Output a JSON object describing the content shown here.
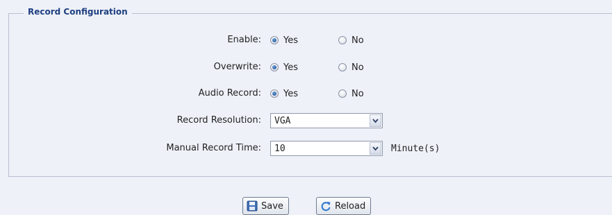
{
  "fieldset": {
    "legend": "Record Configuration"
  },
  "rows": [
    {
      "label": "Enable:",
      "yes": "Yes",
      "no": "No",
      "selected": "Yes"
    },
    {
      "label": "Overwrite:",
      "yes": "Yes",
      "no": "No",
      "selected": "Yes"
    },
    {
      "label": "Audio Record:",
      "yes": "Yes",
      "no": "No",
      "selected": "Yes"
    }
  ],
  "resolution": {
    "label": "Record Resolution:",
    "value": "VGA"
  },
  "manual_time": {
    "label": "Manual Record Time:",
    "value": "10",
    "unit": "Minute(s)"
  },
  "buttons": {
    "save": "Save",
    "reload": "Reload"
  },
  "icons": {
    "save": "floppy-disk-icon",
    "reload": "refresh-icon",
    "dropdown": "chevron-down-icon"
  }
}
